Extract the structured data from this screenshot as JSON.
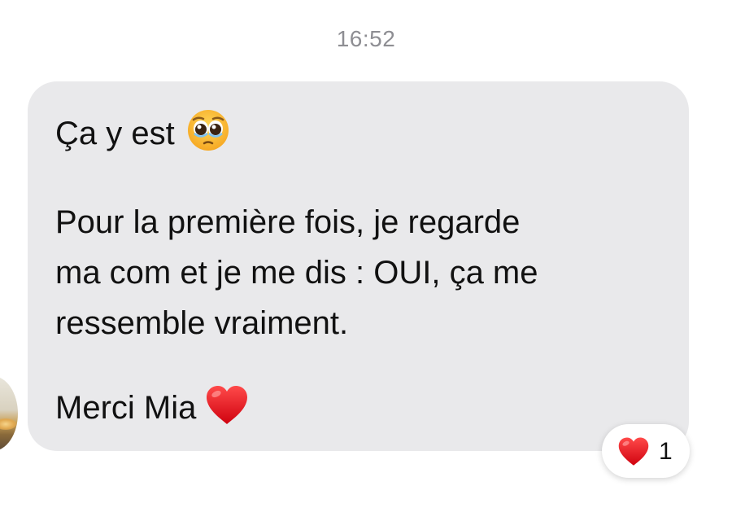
{
  "timestamp": "16:52",
  "message": {
    "lines": [
      "Ça y est",
      "Pour la première fois, je regarde",
      "ma com et je me dis : OUI, ça me",
      "ressemble vraiment.",
      "Merci Mia"
    ],
    "emojis": [
      "pleading-face-icon",
      "red-heart-icon"
    ],
    "bubble_color": "#e9e9eb"
  },
  "reaction": {
    "icon": "red-heart-icon",
    "count": "1",
    "heart_color": "#e8101c"
  }
}
